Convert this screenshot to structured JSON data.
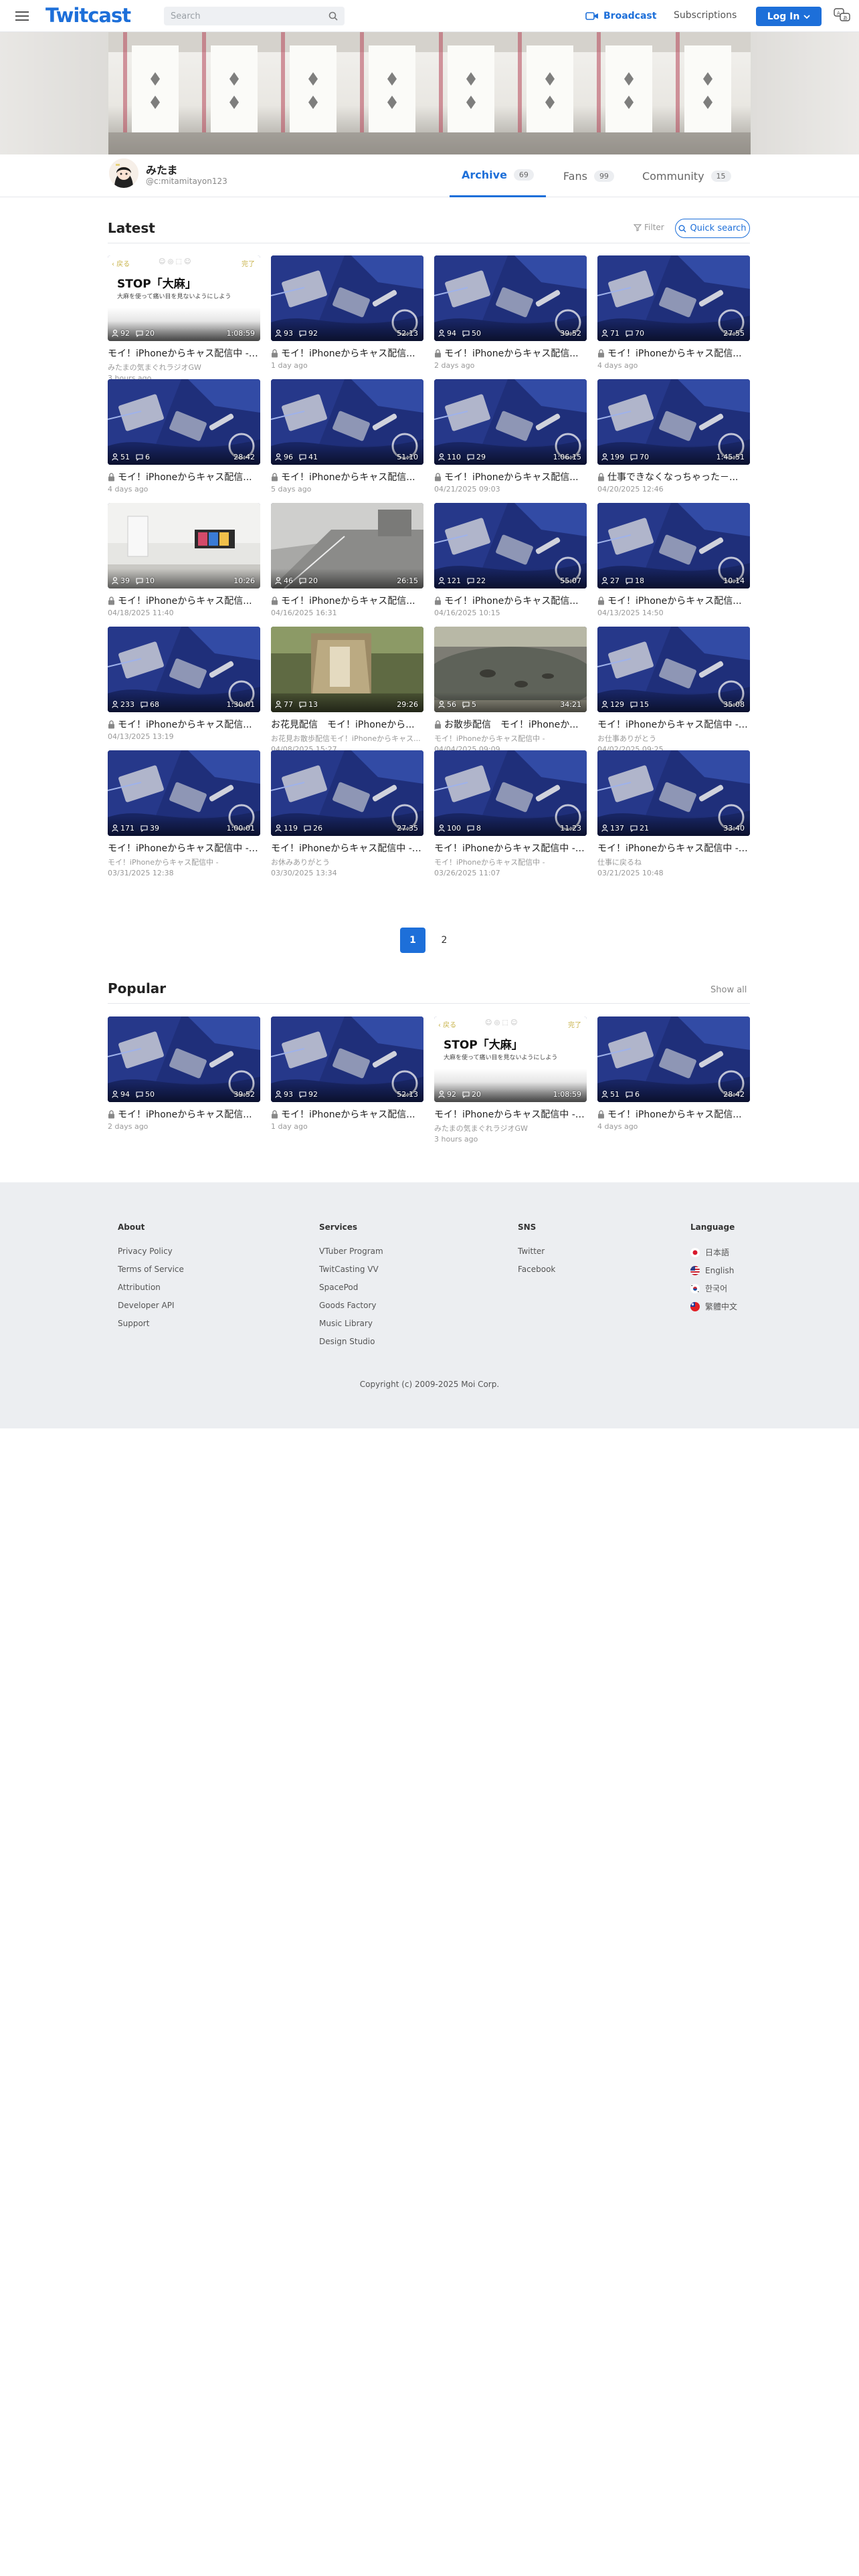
{
  "header": {
    "logo": "Twitcast",
    "search_placeholder": "Search",
    "broadcast": "Broadcast",
    "subscriptions": "Subscriptions",
    "login": "Log In"
  },
  "profile": {
    "name": "みたま",
    "id": "@c:mitamitayon123",
    "tabs": [
      {
        "label": "Archive",
        "count": "69"
      },
      {
        "label": "Fans",
        "count": "99"
      },
      {
        "label": "Community",
        "count": "15"
      }
    ]
  },
  "latest": {
    "title": "Latest",
    "filter": "Filter",
    "quick_search": "Quick search",
    "items": [
      {
        "title": "モイ！iPhoneからキャス配信中 - ...",
        "sub": "みたまの気まぐれラジオGW",
        "date": "3 hours ago",
        "viewers": "92",
        "comments": "20",
        "duration": "1:08:59",
        "locked": false,
        "thumb": "text"
      },
      {
        "title": "モイ！iPhoneからキャス配信...",
        "sub": "",
        "date": "1 day ago",
        "viewers": "93",
        "comments": "92",
        "duration": "52:13",
        "locked": true,
        "thumb": "blue"
      },
      {
        "title": "モイ！iPhoneからキャス配信...",
        "sub": "",
        "date": "2 days ago",
        "viewers": "94",
        "comments": "50",
        "duration": "39:52",
        "locked": true,
        "thumb": "blue"
      },
      {
        "title": "モイ！iPhoneからキャス配信...",
        "sub": "",
        "date": "4 days ago",
        "viewers": "71",
        "comments": "70",
        "duration": "27:55",
        "locked": true,
        "thumb": "blue"
      },
      {
        "title": "モイ！iPhoneからキャス配信...",
        "sub": "",
        "date": "4 days ago",
        "viewers": "51",
        "comments": "6",
        "duration": "28:42",
        "locked": true,
        "thumb": "blue"
      },
      {
        "title": "モイ！iPhoneからキャス配信...",
        "sub": "",
        "date": "5 days ago",
        "viewers": "96",
        "comments": "41",
        "duration": "51:10",
        "locked": true,
        "thumb": "blue"
      },
      {
        "title": "モイ！iPhoneからキャス配信...",
        "sub": "",
        "date": "04/21/2025 09:03",
        "viewers": "110",
        "comments": "29",
        "duration": "1:06:15",
        "locked": true,
        "thumb": "blue"
      },
      {
        "title": "仕事できなくなっちゃった－...",
        "sub": "",
        "date": "04/20/2025 12:46",
        "viewers": "199",
        "comments": "70",
        "duration": "1:45:51",
        "locked": true,
        "thumb": "blue"
      },
      {
        "title": "モイ！iPhoneからキャス配信...",
        "sub": "",
        "date": "04/18/2025 11:40",
        "viewers": "39",
        "comments": "10",
        "duration": "10:26",
        "locked": true,
        "thumb": "room"
      },
      {
        "title": "モイ！iPhoneからキャス配信...",
        "sub": "",
        "date": "04/16/2025 16:31",
        "viewers": "46",
        "comments": "20",
        "duration": "26:15",
        "locked": true,
        "thumb": "street"
      },
      {
        "title": "モイ！iPhoneからキャス配信...",
        "sub": "",
        "date": "04/16/2025 10:15",
        "viewers": "121",
        "comments": "22",
        "duration": "55:07",
        "locked": true,
        "thumb": "blue"
      },
      {
        "title": "モイ！iPhoneからキャス配信...",
        "sub": "",
        "date": "04/13/2025 14:50",
        "viewers": "27",
        "comments": "18",
        "duration": "10:14",
        "locked": true,
        "thumb": "blue"
      },
      {
        "title": "モイ！iPhoneからキャス配信...",
        "sub": "",
        "date": "04/13/2025 13:19",
        "viewers": "233",
        "comments": "68",
        "duration": "1:30:01",
        "locked": true,
        "thumb": "blue"
      },
      {
        "title": "お花見配信　モイ！iPhoneから...",
        "sub": "お花見お散歩配信モイ！iPhoneからキャス...",
        "date": "04/08/2025 15:27",
        "viewers": "77",
        "comments": "13",
        "duration": "29:26",
        "locked": false,
        "thumb": "tree"
      },
      {
        "title": "お散歩配信　モイ！iPhoneか...",
        "sub": "モイ！iPhoneからキャス配信中 -",
        "date": "04/04/2025 09:09",
        "viewers": "56",
        "comments": "5",
        "duration": "34:21",
        "locked": true,
        "thumb": "pond"
      },
      {
        "title": "モイ！iPhoneからキャス配信中 - ...",
        "sub": "お仕事ありがとう",
        "date": "04/02/2025 09:25",
        "viewers": "129",
        "comments": "15",
        "duration": "35:08",
        "locked": false,
        "thumb": "blue"
      },
      {
        "title": "モイ！iPhoneからキャス配信中 - ...",
        "sub": "モイ！iPhoneからキャス配信中 -",
        "date": "03/31/2025 12:38",
        "viewers": "171",
        "comments": "39",
        "duration": "1:00:01",
        "locked": false,
        "thumb": "blue"
      },
      {
        "title": "モイ！iPhoneからキャス配信中 - ...",
        "sub": "お休みありがとう",
        "date": "03/30/2025 13:34",
        "viewers": "119",
        "comments": "26",
        "duration": "27:35",
        "locked": false,
        "thumb": "blue"
      },
      {
        "title": "モイ！iPhoneからキャス配信中 - ...",
        "sub": "モイ！iPhoneからキャス配信中 -",
        "date": "03/26/2025 11:07",
        "viewers": "100",
        "comments": "8",
        "duration": "11:23",
        "locked": false,
        "thumb": "blue"
      },
      {
        "title": "モイ！iPhoneからキャス配信中 - ...",
        "sub": "仕事に戻るね",
        "date": "03/21/2025 10:48",
        "viewers": "137",
        "comments": "21",
        "duration": "33:40",
        "locked": false,
        "thumb": "blue"
      }
    ]
  },
  "pagination": {
    "pages": [
      "1",
      "2"
    ],
    "current": "1"
  },
  "popular": {
    "title": "Popular",
    "show_all": "Show all",
    "items": [
      {
        "title": "モイ！iPhoneからキャス配信...",
        "sub": "",
        "date": "2 days ago",
        "viewers": "94",
        "comments": "50",
        "duration": "39:52",
        "locked": true,
        "thumb": "blue"
      },
      {
        "title": "モイ！iPhoneからキャス配信...",
        "sub": "",
        "date": "1 day ago",
        "viewers": "93",
        "comments": "92",
        "duration": "52:13",
        "locked": true,
        "thumb": "blue"
      },
      {
        "title": "モイ！iPhoneからキャス配信中 - ...",
        "sub": "みたまの気まぐれラジオGW",
        "date": "3 hours ago",
        "viewers": "92",
        "comments": "20",
        "duration": "1:08:59",
        "locked": false,
        "thumb": "text"
      },
      {
        "title": "モイ！iPhoneからキャス配信...",
        "sub": "",
        "date": "4 days ago",
        "viewers": "51",
        "comments": "6",
        "duration": "28:42",
        "locked": true,
        "thumb": "blue"
      }
    ]
  },
  "text_thumb": {
    "back": "戻る",
    "done": "完了",
    "headline": "STOP「大麻」",
    "caption": "大麻を使って痛い目を見ないようにしよう"
  },
  "footer": {
    "columns": [
      {
        "heading": "About",
        "links": [
          "Privacy Policy",
          "Terms of Service",
          "Attribution",
          "Developer API",
          "Support"
        ]
      },
      {
        "heading": "Services",
        "links": [
          "VTuber Program",
          "TwitCasting VV",
          "SpacePod",
          "Goods Factory",
          "Music Library",
          "Design Studio"
        ]
      },
      {
        "heading": "SNS",
        "links": [
          "Twitter",
          "Facebook"
        ]
      },
      {
        "heading": "Language",
        "links": [
          "日本語",
          "English",
          "한국어",
          "繁體中文"
        ]
      }
    ],
    "copyright": "Copyright (c) 2009-2025 Moi Corp."
  },
  "colors": {
    "accent": "#1d6fd9",
    "footer_bg": "#eceef1",
    "thumb_blue": "#1c2b6e"
  }
}
